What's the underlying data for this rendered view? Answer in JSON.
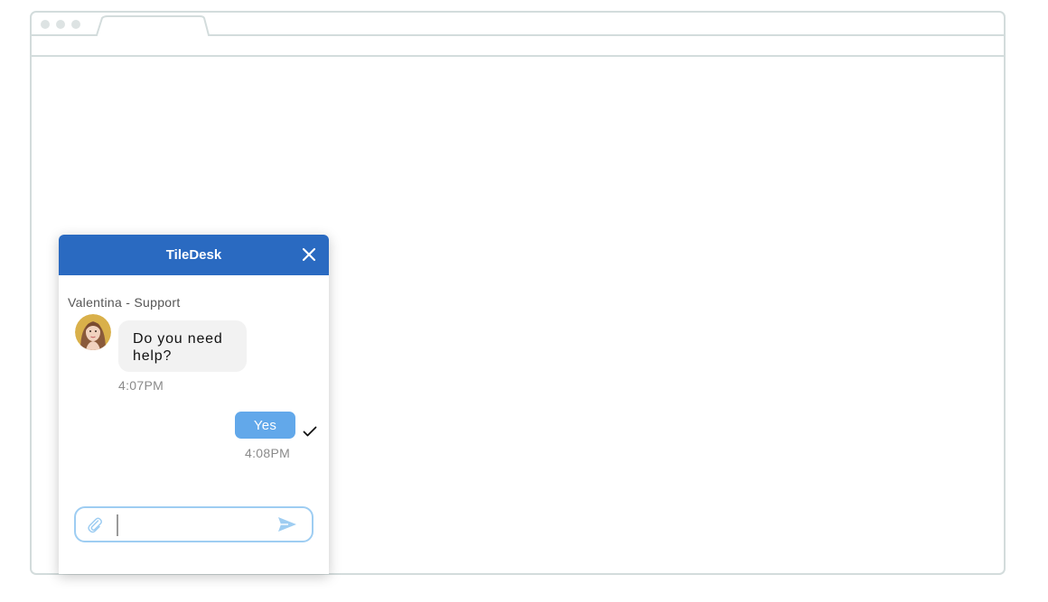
{
  "chat": {
    "title": "TileDesk",
    "agent_name": "Valentina - Support",
    "messages": [
      {
        "from": "agent",
        "text": "Do you need help?",
        "time": "4:07PM"
      },
      {
        "from": "user",
        "text": "Yes",
        "time": "4:08PM",
        "status": "check-icon"
      }
    ],
    "input": {
      "value": "",
      "placeholder": ""
    }
  },
  "icons": {
    "close": "close-icon",
    "attach": "paperclip-icon",
    "send": "send-icon",
    "delivered": "check-icon"
  },
  "colors": {
    "header": "#2a6ac1",
    "user_bubble": "#62a8ea",
    "agent_bubble": "#f2f2f2",
    "composer_border": "#9ecdf2",
    "browser_frame": "#d3dcdc"
  }
}
